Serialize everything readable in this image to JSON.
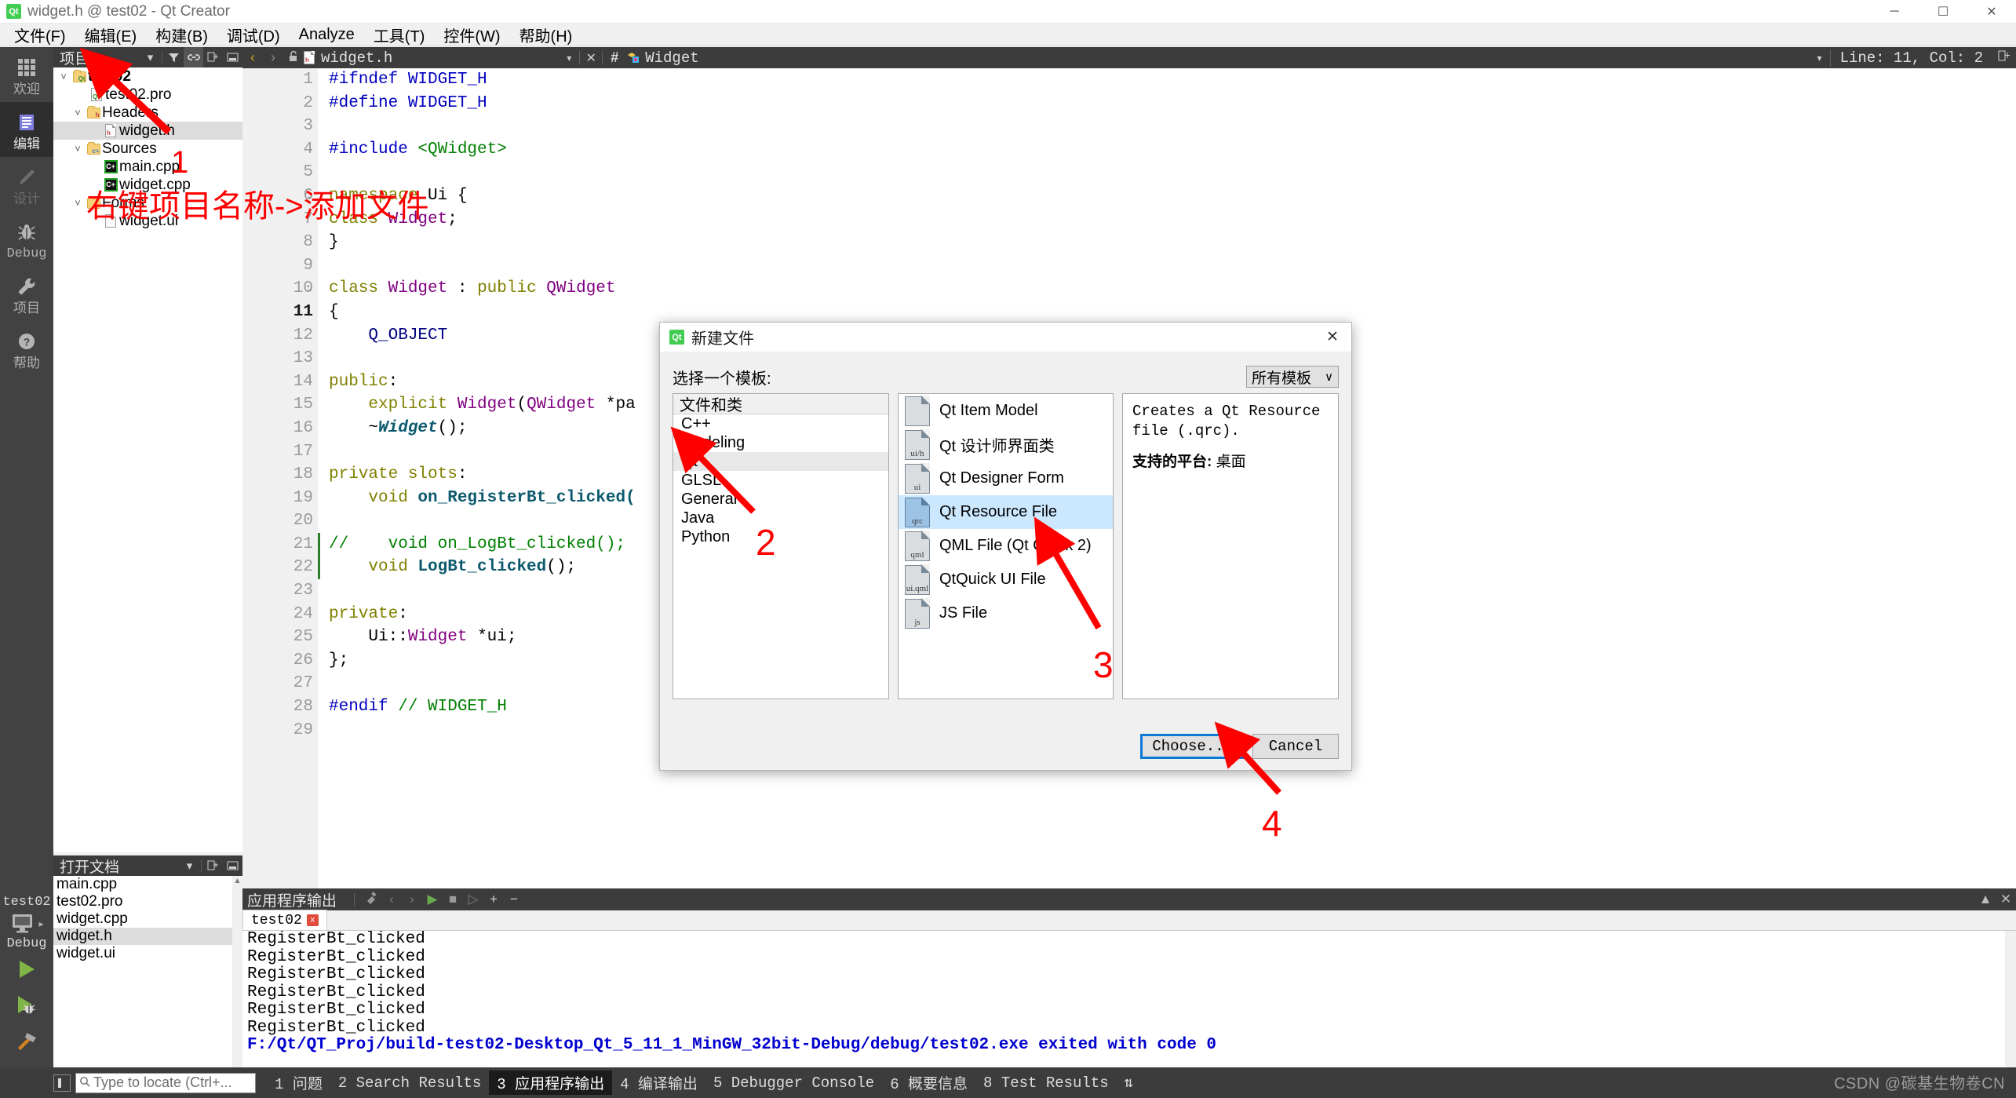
{
  "window": {
    "title": "widget.h @ test02 - Qt Creator",
    "logo_text": "Qt",
    "minimize": "─",
    "maximize": "☐",
    "close": "✕"
  },
  "menubar": {
    "items": [
      {
        "label": "文件(F)",
        "mnemonic": "F"
      },
      {
        "label": "编辑(E)",
        "mnemonic": "E"
      },
      {
        "label": "构建(B)",
        "mnemonic": "B"
      },
      {
        "label": "调试(D)",
        "mnemonic": "D"
      },
      {
        "label": "Analyze",
        "mnemonic": "A"
      },
      {
        "label": "工具(T)",
        "mnemonic": "T"
      },
      {
        "label": "控件(W)",
        "mnemonic": "W"
      },
      {
        "label": "帮助(H)",
        "mnemonic": "H"
      }
    ]
  },
  "modebar": {
    "modes": [
      {
        "label": "欢迎",
        "icon": "grid-icon",
        "state": "normal"
      },
      {
        "label": "编辑",
        "icon": "document-lines-icon",
        "state": "active"
      },
      {
        "label": "设计",
        "icon": "pencil-icon",
        "state": "disabled"
      },
      {
        "label": "Debug",
        "icon": "bug-icon",
        "state": "normal"
      },
      {
        "label": "项目",
        "icon": "wrench-icon",
        "state": "normal"
      },
      {
        "label": "帮助",
        "icon": "question-circle-icon",
        "state": "normal"
      }
    ],
    "kit": {
      "project": "test02",
      "build_config": "Debug",
      "icon": "monitor-icon"
    },
    "run_buttons": [
      {
        "name": "run-button",
        "icon": "play-triangle-icon",
        "color": "#82b548"
      },
      {
        "name": "debug-button",
        "icon": "play-bug-icon",
        "color": "#82b548"
      },
      {
        "name": "build-button",
        "icon": "hammer-icon",
        "color": "#c8821e"
      }
    ]
  },
  "project_panel": {
    "title": "项目",
    "toolbar": [
      "filter-dropdown-icon",
      "filter-icon",
      "link-icon",
      "split-icon",
      "close-icon"
    ],
    "tree": [
      {
        "depth": 0,
        "label": "test02",
        "icon": "qt-folder-icon",
        "expanded": true,
        "bold": true,
        "selected": false
      },
      {
        "depth": 1,
        "label": "test02.pro",
        "icon": "qt-pro-file-icon",
        "expanded": null,
        "bold": false,
        "selected": false
      },
      {
        "depth": 1,
        "label": "Headers",
        "icon": "h-folder-icon",
        "expanded": true,
        "bold": false,
        "selected": false
      },
      {
        "depth": 2,
        "label": "widget.h",
        "icon": "h-file-icon",
        "expanded": null,
        "bold": false,
        "selected": true
      },
      {
        "depth": 1,
        "label": "Sources",
        "icon": "cpp-folder-icon",
        "expanded": true,
        "bold": false,
        "selected": false
      },
      {
        "depth": 2,
        "label": "main.cpp",
        "icon": "cpp-file-icon",
        "expanded": null,
        "bold": false,
        "selected": false
      },
      {
        "depth": 2,
        "label": "widget.cpp",
        "icon": "cpp-file-icon",
        "expanded": null,
        "bold": false,
        "selected": false
      },
      {
        "depth": 1,
        "label": "Forms",
        "icon": "forms-folder-icon",
        "expanded": true,
        "bold": false,
        "selected": false
      },
      {
        "depth": 2,
        "label": "widget.ui",
        "icon": "ui-file-icon",
        "expanded": null,
        "bold": false,
        "selected": false
      }
    ]
  },
  "open_documents": {
    "title": "打开文档",
    "toolbar": [
      "dropdown-icon",
      "split-icon",
      "close-icon"
    ],
    "items": [
      {
        "label": "main.cpp",
        "selected": false
      },
      {
        "label": "test02.pro",
        "selected": false
      },
      {
        "label": "widget.cpp",
        "selected": false
      },
      {
        "label": "widget.h",
        "selected": true
      },
      {
        "label": "widget.ui",
        "selected": false
      }
    ]
  },
  "editor": {
    "toolbar": {
      "back": "‹",
      "forward": "›",
      "lock_icon": "unlock-icon",
      "file_icon": "h-file-icon",
      "filename": "widget.h",
      "dropdown": "▾",
      "close": "✕",
      "hash": "#",
      "symbol_icon": "class-icon",
      "symbol": "Widget",
      "line_col": "Line: 11, Col: 2",
      "split_icon": "split-icon"
    },
    "cursor": {
      "line": 11,
      "col": 2
    },
    "lines": [
      {
        "n": 1,
        "fold": "",
        "tokens": [
          {
            "t": "#ifndef ",
            "c": "kpre"
          },
          {
            "t": "WIDGET_H",
            "c": "kpre"
          }
        ]
      },
      {
        "n": 2,
        "fold": "",
        "tokens": [
          {
            "t": "#define ",
            "c": "kpre"
          },
          {
            "t": "WIDGET_H",
            "c": "kpre"
          }
        ]
      },
      {
        "n": 3,
        "fold": "",
        "tokens": []
      },
      {
        "n": 4,
        "fold": "",
        "tokens": [
          {
            "t": "#include ",
            "c": "kpre"
          },
          {
            "t": "<QWidget>",
            "c": "kstr"
          }
        ]
      },
      {
        "n": 5,
        "fold": "",
        "tokens": []
      },
      {
        "n": 6,
        "fold": "v",
        "tokens": [
          {
            "t": "namespace ",
            "c": "k1"
          },
          {
            "t": "Ui ",
            "c": "kplain"
          },
          {
            "t": "{",
            "c": "kplain"
          }
        ]
      },
      {
        "n": 7,
        "fold": "",
        "tokens": [
          {
            "t": "class ",
            "c": "k1"
          },
          {
            "t": "Widget",
            "c": "ktype"
          },
          {
            "t": ";",
            "c": "kplain"
          }
        ]
      },
      {
        "n": 8,
        "fold": "",
        "tokens": [
          {
            "t": "}",
            "c": "kplain"
          }
        ]
      },
      {
        "n": 9,
        "fold": "",
        "tokens": []
      },
      {
        "n": 10,
        "fold": "v",
        "tokens": [
          {
            "t": "class ",
            "c": "k1"
          },
          {
            "t": "Widget",
            "c": "ktype"
          },
          {
            "t": " : ",
            "c": "kplain"
          },
          {
            "t": "public ",
            "c": "k1"
          },
          {
            "t": "QWidget",
            "c": "ktype"
          }
        ]
      },
      {
        "n": 11,
        "fold": "",
        "tokens": [
          {
            "t": "{",
            "c": "kplain"
          }
        ]
      },
      {
        "n": 12,
        "fold": "",
        "tokens": [
          {
            "t": "    Q_OBJECT",
            "c": "kmacro"
          }
        ]
      },
      {
        "n": 13,
        "fold": "",
        "tokens": []
      },
      {
        "n": 14,
        "fold": "",
        "tokens": [
          {
            "t": "public",
            "c": "k1"
          },
          {
            "t": ":",
            "c": "kplain"
          }
        ]
      },
      {
        "n": 15,
        "fold": "",
        "tokens": [
          {
            "t": "    explicit ",
            "c": "k1"
          },
          {
            "t": "Widget",
            "c": "ktype"
          },
          {
            "t": "(",
            "c": "kplain"
          },
          {
            "t": "QWidget",
            "c": "ktype"
          },
          {
            "t": " *pa",
            "c": "kplain"
          }
        ]
      },
      {
        "n": 16,
        "fold": "",
        "tokens": [
          {
            "t": "    ~",
            "c": "kplain"
          },
          {
            "t": "Widget",
            "c": "kdtor"
          },
          {
            "t": "();",
            "c": "kplain"
          }
        ]
      },
      {
        "n": 17,
        "fold": "",
        "tokens": []
      },
      {
        "n": 18,
        "fold": "",
        "tokens": [
          {
            "t": "private slots",
            "c": "k1"
          },
          {
            "t": ":",
            "c": "kplain"
          }
        ]
      },
      {
        "n": 19,
        "fold": "",
        "tokens": [
          {
            "t": "    void ",
            "c": "k1"
          },
          {
            "t": "on_RegisterBt_clicked(",
            "c": "kfunc"
          }
        ]
      },
      {
        "n": 20,
        "fold": "",
        "tokens": []
      },
      {
        "n": 21,
        "fold": "",
        "tokens": [
          {
            "t": "//    void on_LogBt_clicked();",
            "c": "kcom"
          }
        ]
      },
      {
        "n": 22,
        "fold": "",
        "tokens": [
          {
            "t": "    void ",
            "c": "k1"
          },
          {
            "t": "LogBt_clicked",
            "c": "kfunc"
          },
          {
            "t": "();",
            "c": "kplain"
          }
        ]
      },
      {
        "n": 23,
        "fold": "",
        "tokens": []
      },
      {
        "n": 24,
        "fold": "",
        "tokens": [
          {
            "t": "private",
            "c": "k1"
          },
          {
            "t": ":",
            "c": "kplain"
          }
        ]
      },
      {
        "n": 25,
        "fold": "",
        "tokens": [
          {
            "t": "    Ui",
            "c": "kplain"
          },
          {
            "t": "::",
            "c": "kplain"
          },
          {
            "t": "Widget",
            "c": "ktype"
          },
          {
            "t": " *ui;",
            "c": "kplain"
          }
        ]
      },
      {
        "n": 26,
        "fold": "",
        "tokens": [
          {
            "t": "};",
            "c": "kplain"
          }
        ]
      },
      {
        "n": 27,
        "fold": "",
        "tokens": []
      },
      {
        "n": 28,
        "fold": "",
        "tokens": [
          {
            "t": "#endif ",
            "c": "kpre"
          },
          {
            "t": "// WIDGET_H",
            "c": "kcom"
          }
        ]
      },
      {
        "n": 29,
        "fold": "",
        "tokens": []
      }
    ]
  },
  "output_pane": {
    "title": "应用程序输出",
    "toolbar": [
      "clear-icon",
      "prev-icon",
      "next-icon",
      "run-icon",
      "stop-icon",
      "attach-icon",
      "plus-icon",
      "minus-icon"
    ],
    "tab": {
      "label": "test02",
      "close": "x"
    },
    "lines": [
      {
        "text": "RegisterBt_clicked",
        "style": "plain"
      },
      {
        "text": "RegisterBt_clicked",
        "style": "plain"
      },
      {
        "text": "RegisterBt_clicked",
        "style": "plain"
      },
      {
        "text": "RegisterBt_clicked",
        "style": "plain"
      },
      {
        "text": "RegisterBt_clicked",
        "style": "plain"
      },
      {
        "text": "RegisterBt_clicked",
        "style": "plain"
      },
      {
        "text": "F:/Qt/QT_Proj/build-test02-Desktop_Qt_5_11_1_MinGW_32bit-Debug/debug/test02.exe exited with code 0",
        "style": "blue"
      }
    ]
  },
  "statusbar": {
    "locator_placeholder": "Type to locate (Ctrl+...",
    "search_icon": "magnifier-icon",
    "tabs": [
      {
        "num": "1",
        "label": "问题",
        "active": false
      },
      {
        "num": "2",
        "label": "Search Results",
        "active": false
      },
      {
        "num": "3",
        "label": "应用程序输出",
        "active": true
      },
      {
        "num": "4",
        "label": "编译输出",
        "active": false
      },
      {
        "num": "5",
        "label": "Debugger Console",
        "active": false
      },
      {
        "num": "6",
        "label": "概要信息",
        "active": false
      },
      {
        "num": "8",
        "label": "Test Results",
        "active": false
      }
    ],
    "updown": "⇅",
    "watermark": "CSDN @碳基生物卷CN"
  },
  "dialog": {
    "title": "新建文件",
    "logo_text": "Qt",
    "close": "✕",
    "prompt": "选择一个模板:",
    "template_filter": {
      "value": "所有模板",
      "arrow": "∨"
    },
    "categories_header": "文件和类",
    "categories": [
      {
        "label": "C++",
        "selected": false
      },
      {
        "label": "Modeling",
        "selected": false
      },
      {
        "label": "Qt",
        "selected": true
      },
      {
        "label": "GLSL",
        "selected": false
      },
      {
        "label": "General",
        "selected": false
      },
      {
        "label": "Java",
        "selected": false
      },
      {
        "label": "Python",
        "selected": false
      }
    ],
    "templates": [
      {
        "label": "Qt Item Model",
        "tag": "",
        "selected": false
      },
      {
        "label": "Qt 设计师界面类",
        "tag": "ui/h",
        "selected": false
      },
      {
        "label": "Qt Designer Form",
        "tag": "ui",
        "selected": false
      },
      {
        "label": "Qt Resource File",
        "tag": "qrc",
        "selected": true
      },
      {
        "label": "QML File (Qt Quick 2)",
        "tag": "qml",
        "selected": false
      },
      {
        "label": "QtQuick UI File",
        "tag": "ui.qml",
        "selected": false
      },
      {
        "label": "JS File",
        "tag": "js",
        "selected": false
      }
    ],
    "description": {
      "text": "Creates a Qt Resource file (.qrc).",
      "platform_label": "支持的平台:",
      "platform_value": "桌面"
    },
    "buttons": [
      {
        "label": "Choose...",
        "default": true
      },
      {
        "label": "Cancel",
        "default": false
      }
    ]
  },
  "annotations": {
    "color": "#fe0000",
    "items": [
      {
        "name": "annotation-1",
        "label": "1"
      },
      {
        "name": "annotation-2",
        "label": "2"
      },
      {
        "name": "annotation-3",
        "label": "3"
      },
      {
        "name": "annotation-4",
        "label": "4"
      },
      {
        "name": "annotation-step-text",
        "label": "右键项目名称->添加文件"
      }
    ]
  }
}
